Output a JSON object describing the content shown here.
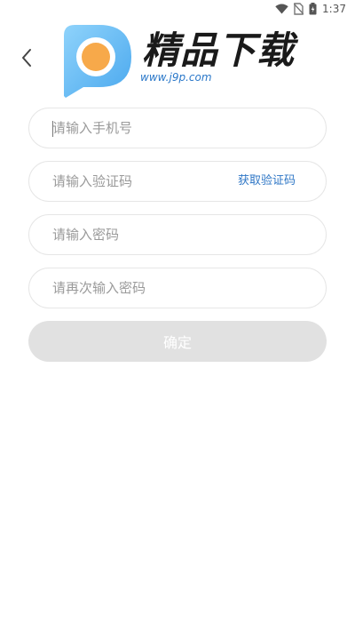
{
  "status_bar": {
    "time": "1:37",
    "icons": [
      "wifi-icon",
      "no-sim-icon",
      "battery-icon"
    ]
  },
  "header": {
    "back_icon": "chevron-left-icon",
    "logo": {
      "name": "精品下载",
      "url": "www.j9p.com"
    }
  },
  "form": {
    "phone": {
      "placeholder": "请输入手机号",
      "value": ""
    },
    "code": {
      "placeholder": "请输入验证码",
      "value": "",
      "action_label": "获取验证码"
    },
    "password": {
      "placeholder": "请输入密码",
      "value": ""
    },
    "confirm_password": {
      "placeholder": "请再次输入密码",
      "value": ""
    },
    "submit_label": "确定"
  },
  "colors": {
    "link": "#2f77c6",
    "button_disabled": "#e1e1e1",
    "field_border": "#e6e6e6",
    "logo_blue": "#59b6f2",
    "logo_orange": "#f7a94a"
  }
}
